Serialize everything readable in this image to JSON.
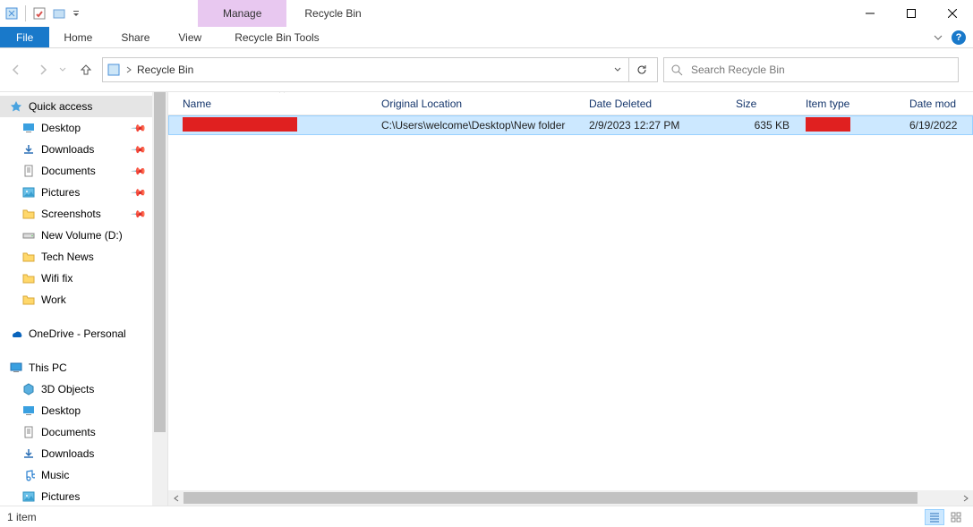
{
  "title": "Recycle Bin",
  "context_tab": "Manage",
  "ribbon": {
    "file": "File",
    "home": "Home",
    "share": "Share",
    "view": "View",
    "tools": "Recycle Bin Tools"
  },
  "address": {
    "crumb": "Recycle Bin"
  },
  "search": {
    "placeholder": "Search Recycle Bin"
  },
  "sidebar": {
    "quick_access": "Quick access",
    "desktop": "Desktop",
    "downloads": "Downloads",
    "documents": "Documents",
    "pictures": "Pictures",
    "screenshots": "Screenshots",
    "new_volume": "New Volume (D:)",
    "tech_news": "Tech News",
    "wifi_fix": "Wifi fix",
    "work": "Work",
    "onedrive": "OneDrive - Personal",
    "this_pc": "This PC",
    "objects3d": "3D Objects",
    "desktop2": "Desktop",
    "documents2": "Documents",
    "downloads2": "Downloads",
    "music": "Music",
    "pictures2": "Pictures"
  },
  "columns": {
    "name": "Name",
    "loc": "Original Location",
    "del": "Date Deleted",
    "size": "Size",
    "type": "Item type",
    "mod": "Date mod"
  },
  "rows": [
    {
      "name_redacted": true,
      "loc": "C:\\Users\\welcome\\Desktop\\New folder",
      "del": "2/9/2023 12:27 PM",
      "size": "635 KB",
      "type_redacted": true,
      "mod": "6/19/2022"
    }
  ],
  "status": {
    "count": "1 item"
  }
}
